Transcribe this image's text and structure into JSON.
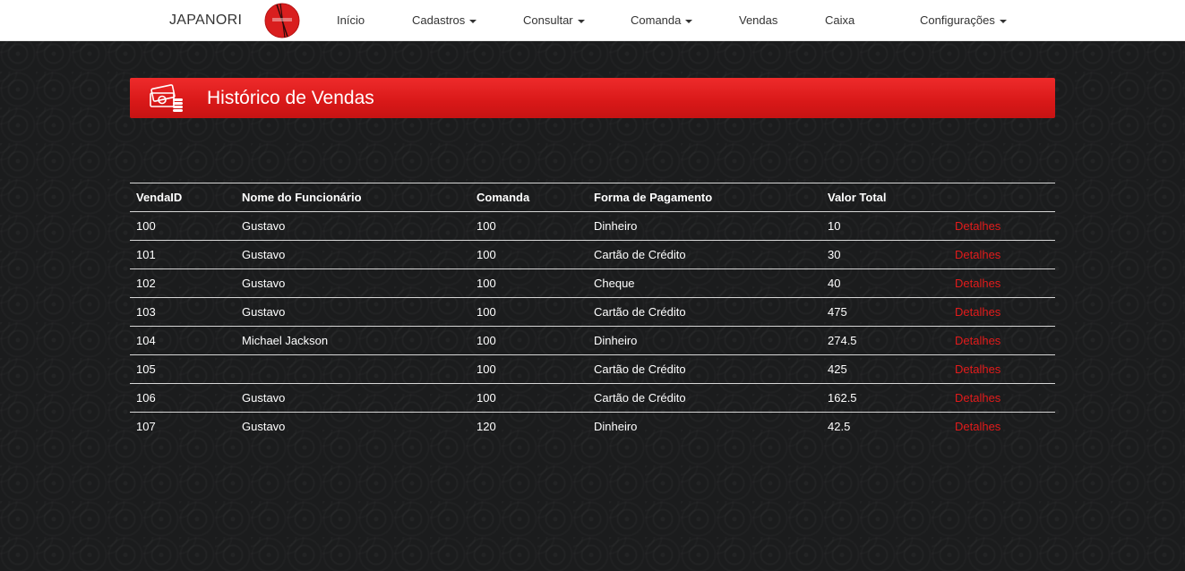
{
  "nav": {
    "brand": "JAPANORI",
    "items": [
      {
        "label": "Início",
        "dropdown": false
      },
      {
        "label": "Cadastros",
        "dropdown": true
      },
      {
        "label": "Consultar",
        "dropdown": true
      },
      {
        "label": "Comanda",
        "dropdown": true
      },
      {
        "label": "Vendas",
        "dropdown": false
      },
      {
        "label": "Caixa",
        "dropdown": false
      },
      {
        "label": "Configurações",
        "dropdown": true
      }
    ]
  },
  "banner": {
    "title": "Histórico de Vendas",
    "icon": "money-cash-icon",
    "color": "#e31b1b"
  },
  "table": {
    "headers": [
      "VendaID",
      "Nome do Funcionário",
      "Comanda",
      "Forma de Pagamento",
      "Valor Total",
      ""
    ],
    "rows": [
      {
        "id": "100",
        "funcionario": "Gustavo",
        "comanda": "100",
        "pagamento": "Dinheiro",
        "valor": "10",
        "acao": "Detalhes"
      },
      {
        "id": "101",
        "funcionario": "Gustavo",
        "comanda": "100",
        "pagamento": "Cartão de Crédito",
        "valor": "30",
        "acao": "Detalhes"
      },
      {
        "id": "102",
        "funcionario": "Gustavo",
        "comanda": "100",
        "pagamento": "Cheque",
        "valor": "40",
        "acao": "Detalhes"
      },
      {
        "id": "103",
        "funcionario": "Gustavo",
        "comanda": "100",
        "pagamento": "Cartão de Crédito",
        "valor": "475",
        "acao": "Detalhes"
      },
      {
        "id": "104",
        "funcionario": "Michael Jackson",
        "comanda": "100",
        "pagamento": "Dinheiro",
        "valor": "274.5",
        "acao": "Detalhes"
      },
      {
        "id": "105",
        "funcionario": "",
        "comanda": "100",
        "pagamento": "Cartão de Crédito",
        "valor": "425",
        "acao": "Detalhes"
      },
      {
        "id": "106",
        "funcionario": "Gustavo",
        "comanda": "100",
        "pagamento": "Cartão de Crédito",
        "valor": "162.5",
        "acao": "Detalhes"
      },
      {
        "id": "107",
        "funcionario": "Gustavo",
        "comanda": "120",
        "pagamento": "Dinheiro",
        "valor": "42.5",
        "acao": "Detalhes"
      }
    ]
  }
}
